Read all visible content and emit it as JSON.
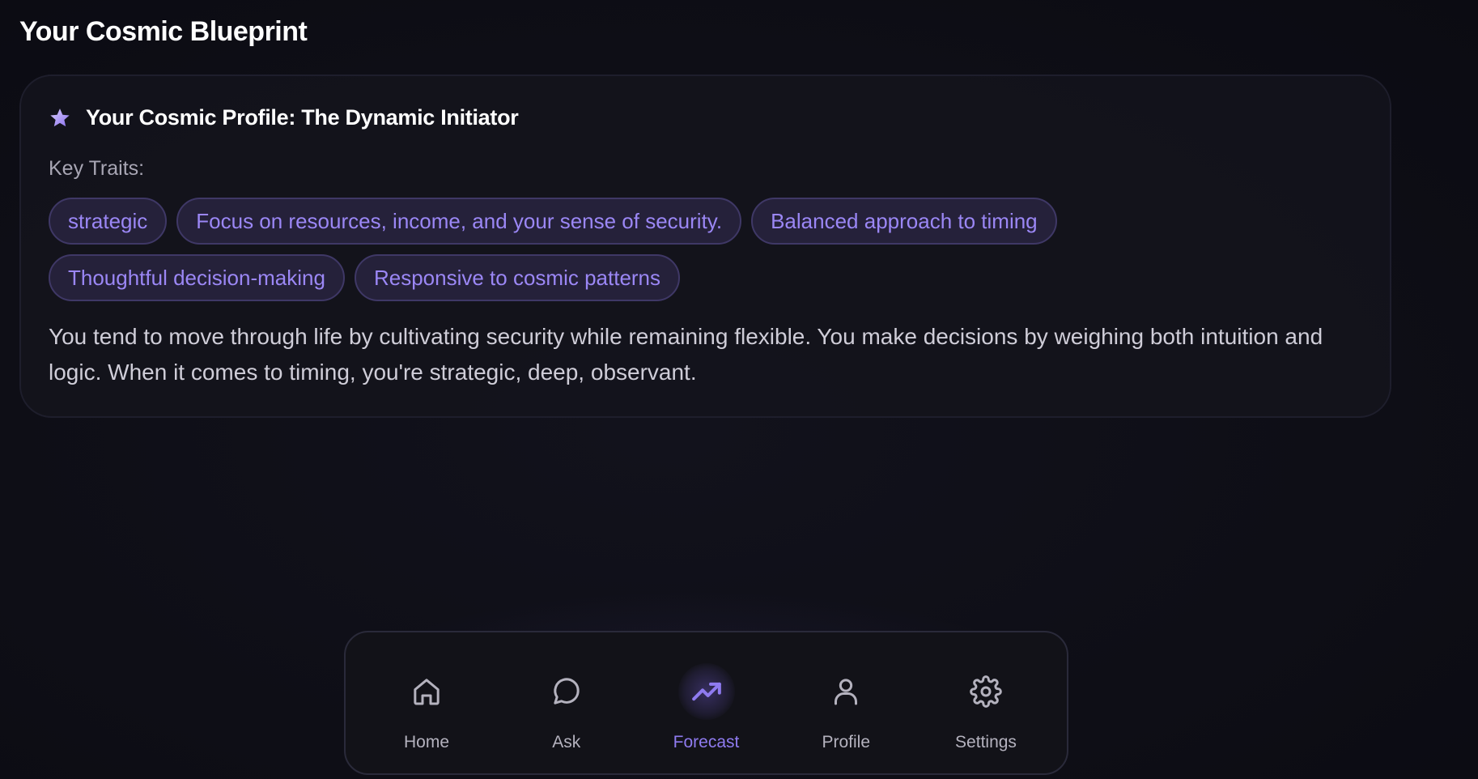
{
  "page": {
    "title": "Your Cosmic Blueprint"
  },
  "profile_card": {
    "title": "Your Cosmic Profile: The Dynamic Initiator",
    "icon": "star-icon",
    "traits_label": "Key Traits:",
    "traits": [
      "strategic",
      "Focus on resources, income, and your sense of security.",
      "Balanced approach to timing",
      "Thoughtful decision-making",
      "Responsive to cosmic patterns"
    ],
    "description": "You tend to move through life by cultivating security while remaining flexible. You make decisions by weighing both intuition and logic. When it comes to timing, you're strategic, deep, observant."
  },
  "nav": {
    "active": "Forecast",
    "items": [
      {
        "label": "Home",
        "icon": "home-icon"
      },
      {
        "label": "Ask",
        "icon": "chat-bubble-icon"
      },
      {
        "label": "Forecast",
        "icon": "trending-up-icon"
      },
      {
        "label": "Profile",
        "icon": "user-icon"
      },
      {
        "label": "Settings",
        "icon": "gear-icon"
      }
    ]
  },
  "colors": {
    "background": "#0f0f17",
    "card": "#14141c",
    "accent": "#8f7bf0",
    "pill_bg": "#25213a",
    "pill_border": "#3f3866",
    "text_muted": "#a8a6b4"
  }
}
